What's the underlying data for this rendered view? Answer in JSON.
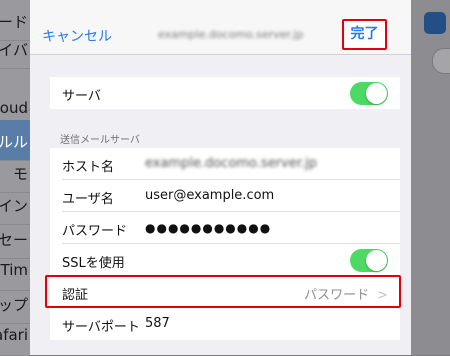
{
  "background": {
    "list_items": [
      {
        "label": "スコード"
      },
      {
        "label": "ライバ"
      },
      {
        "label": ""
      },
      {
        "label": "loud"
      },
      {
        "label": "ールル"
      },
      {
        "label": "モ"
      },
      {
        "label": "マイン"
      },
      {
        "label": "ッセー"
      },
      {
        "label": "aceTim"
      },
      {
        "label": "ップ"
      },
      {
        "label": "afari"
      }
    ]
  },
  "navbar": {
    "cancel_label": "キャンセル",
    "title": "example.docomo.server.jp",
    "done_label": "完了"
  },
  "server_row": {
    "label": "サーバ",
    "toggle_on": true
  },
  "outgoing": {
    "header": "送信メールサーバ",
    "hostname": {
      "label": "ホスト名",
      "value": "example.docomo.server.jp"
    },
    "username": {
      "label": "ユーザ名",
      "value": "user@example.com"
    },
    "password": {
      "label": "パスワード",
      "value": "●●●●●●●●●●●"
    },
    "ssl": {
      "label": "SSLを使用",
      "toggle_on": true
    },
    "auth": {
      "label": "認証",
      "value": "パスワード",
      "chevron": ">"
    },
    "port": {
      "label": "サーバポート",
      "value": "587"
    }
  },
  "colors": {
    "accent": "#1f7bf4",
    "toggle_on": "#4cd964",
    "highlight": "#e0000e"
  }
}
